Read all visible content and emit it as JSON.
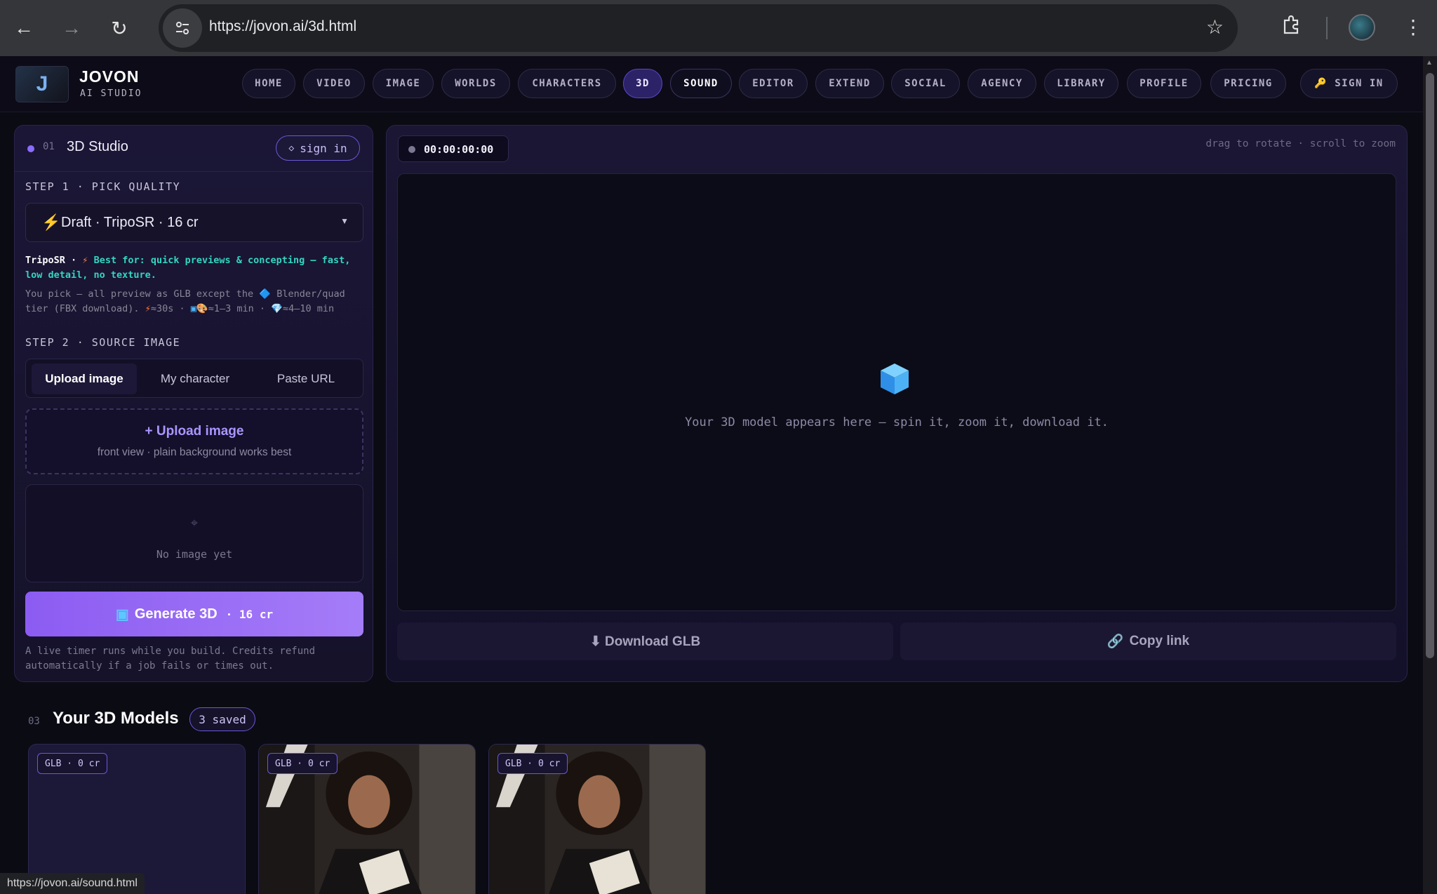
{
  "browser": {
    "url": "https://jovon.ai/3d.html",
    "status_url": "https://jovon.ai/sound.html"
  },
  "brand": {
    "name": "JOVON",
    "sub": "AI STUDIO",
    "logo_letter": "J"
  },
  "nav": [
    "HOME",
    "VIDEO",
    "IMAGE",
    "WORLDS",
    "CHARACTERS",
    "3D",
    "SOUND",
    "EDITOR",
    "EXTEND",
    "SOCIAL",
    "AGENCY",
    "LIBRARY",
    "PROFILE",
    "PRICING"
  ],
  "nav_signin": "SIGN IN",
  "left": {
    "num": "01",
    "title": "3D Studio",
    "signin": "sign in",
    "step1": "STEP 1 · PICK QUALITY",
    "quality": "Draft · TripoSR · 16 cr",
    "tier_name": "TripoSR ·",
    "tier_desc": "Best for: quick previews & concepting — fast, low detail, no texture.",
    "note_a": "You pick — all preview as GLB except the",
    "note_b": "Blender/quad tier (FBX download).",
    "note_c": "≈30s ·",
    "note_d": "≈1–3 min ·",
    "note_e": "≈4–10 min",
    "step2": "STEP 2 · SOURCE IMAGE",
    "tabs": [
      "Upload image",
      "My character",
      "Paste URL"
    ],
    "upload_title": "+ Upload image",
    "upload_sub": "front view · plain background works best",
    "preview_icon": "⌖",
    "preview_text": "No image yet",
    "generate": "Generate 3D",
    "generate_cost": "· 16 cr",
    "footer": "A live timer runs while you build. Credits refund automatically if a job fails or times out."
  },
  "right": {
    "timer": "00:00:00:00",
    "hint": "drag to rotate · scroll to zoom",
    "viewer_text": "Your 3D model appears here — spin it, zoom it, download it.",
    "download": "⬇ Download GLB",
    "copy": "Copy link"
  },
  "models": {
    "num": "03",
    "title": "Your 3D Models",
    "saved": "3 saved",
    "cards": [
      {
        "badge": "GLB · 0 cr"
      },
      {
        "badge": "GLB · 0 cr"
      },
      {
        "badge": "GLB · 0 cr"
      }
    ]
  },
  "colors": {
    "accent": "#8c5cf2",
    "teal": "#33d6c0",
    "bg": "#0b0b14"
  }
}
